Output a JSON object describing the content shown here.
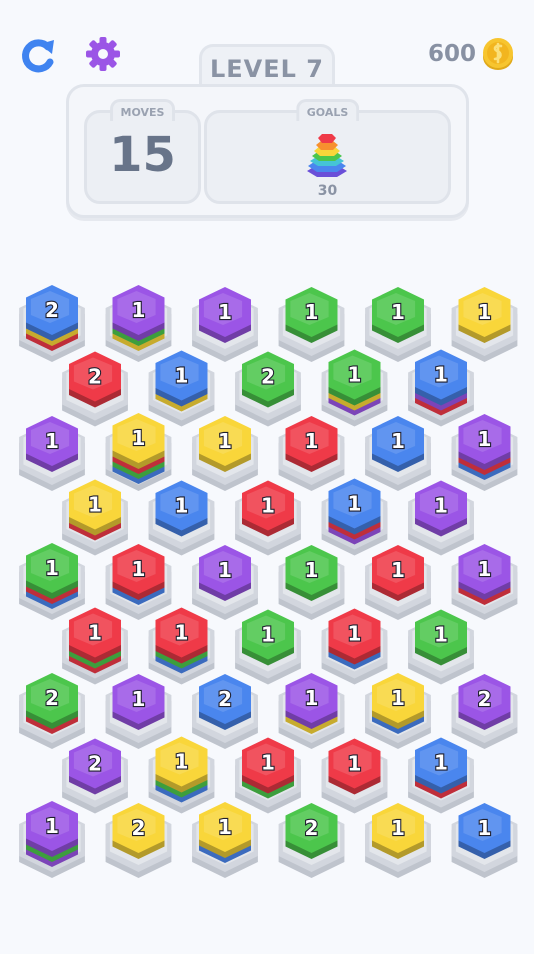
{
  "topbar": {
    "level_label": "LEVEL 7",
    "coins": "600",
    "restart_icon": "restart-icon",
    "settings_icon": "gear-icon"
  },
  "panel": {
    "moves_label": "MOVES",
    "moves_value": "15",
    "goals_label": "GOALS",
    "goal_count": "30",
    "goal_icon": "rainbow-hex-stack-icon"
  },
  "colors": {
    "red": "#ef3a48",
    "blue": "#4a86ee",
    "green": "#4cc64c",
    "purple": "#9b55e6",
    "yellow": "#f9d63a",
    "base": "#d2d6de",
    "page": "#f7f9fd"
  },
  "board": {
    "rows": [
      [
        {
          "color": "blue",
          "value": "2",
          "layers": [
            "yellow",
            "red"
          ]
        },
        {
          "color": "purple",
          "value": "1",
          "layers": [
            "green",
            "yellow"
          ]
        },
        {
          "color": "purple",
          "value": "1",
          "layers": []
        },
        {
          "color": "green",
          "value": "1",
          "layers": []
        },
        {
          "color": "green",
          "value": "1",
          "layers": []
        },
        {
          "color": "yellow",
          "value": "1",
          "layers": []
        }
      ],
      [
        {
          "color": "red",
          "value": "2",
          "layers": []
        },
        {
          "color": "blue",
          "value": "1",
          "layers": [
            "yellow"
          ]
        },
        {
          "color": "green",
          "value": "2",
          "layers": []
        },
        {
          "color": "green",
          "value": "1",
          "layers": [
            "yellow",
            "purple"
          ]
        },
        {
          "color": "blue",
          "value": "1",
          "layers": [
            "purple",
            "red"
          ]
        }
      ],
      [
        {
          "color": "purple",
          "value": "1",
          "layers": []
        },
        {
          "color": "yellow",
          "value": "1",
          "layers": [
            "red",
            "green",
            "blue"
          ]
        },
        {
          "color": "yellow",
          "value": "1",
          "layers": []
        },
        {
          "color": "red",
          "value": "1",
          "layers": []
        },
        {
          "color": "blue",
          "value": "1",
          "layers": []
        },
        {
          "color": "purple",
          "value": "1",
          "layers": [
            "red",
            "blue"
          ]
        }
      ],
      [
        {
          "color": "yellow",
          "value": "1",
          "layers": [
            "red"
          ]
        },
        {
          "color": "blue",
          "value": "1",
          "layers": []
        },
        {
          "color": "red",
          "value": "1",
          "layers": []
        },
        {
          "color": "blue",
          "value": "1",
          "layers": [
            "red",
            "purple"
          ]
        },
        {
          "color": "purple",
          "value": "1",
          "layers": []
        }
      ],
      [
        {
          "color": "green",
          "value": "1",
          "layers": [
            "red",
            "blue"
          ]
        },
        {
          "color": "red",
          "value": "1",
          "layers": [
            "blue"
          ]
        },
        {
          "color": "purple",
          "value": "1",
          "layers": []
        },
        {
          "color": "green",
          "value": "1",
          "layers": []
        },
        {
          "color": "red",
          "value": "1",
          "layers": []
        },
        {
          "color": "purple",
          "value": "1",
          "layers": [
            "red"
          ]
        }
      ],
      [
        {
          "color": "red",
          "value": "1",
          "layers": [
            "green",
            "red"
          ]
        },
        {
          "color": "red",
          "value": "1",
          "layers": [
            "green",
            "blue"
          ]
        },
        {
          "color": "green",
          "value": "1",
          "layers": []
        },
        {
          "color": "red",
          "value": "1",
          "layers": [
            "blue"
          ]
        },
        {
          "color": "green",
          "value": "1",
          "layers": []
        }
      ],
      [
        {
          "color": "green",
          "value": "2",
          "layers": [
            "red"
          ]
        },
        {
          "color": "purple",
          "value": "1",
          "layers": []
        },
        {
          "color": "blue",
          "value": "2",
          "layers": []
        },
        {
          "color": "purple",
          "value": "1",
          "layers": [
            "yellow"
          ]
        },
        {
          "color": "yellow",
          "value": "1",
          "layers": [
            "blue"
          ]
        },
        {
          "color": "purple",
          "value": "2",
          "layers": []
        }
      ],
      [
        {
          "color": "purple",
          "value": "2",
          "layers": []
        },
        {
          "color": "yellow",
          "value": "1",
          "layers": [
            "green",
            "blue"
          ]
        },
        {
          "color": "red",
          "value": "1",
          "layers": [
            "green"
          ]
        },
        {
          "color": "red",
          "value": "1",
          "layers": []
        },
        {
          "color": "blue",
          "value": "1",
          "layers": [
            "red"
          ]
        }
      ],
      [
        {
          "color": "purple",
          "value": "1",
          "layers": [
            "green",
            "purple"
          ]
        },
        {
          "color": "yellow",
          "value": "2",
          "layers": []
        },
        {
          "color": "yellow",
          "value": "1",
          "layers": [
            "blue"
          ]
        },
        {
          "color": "green",
          "value": "2",
          "layers": []
        },
        {
          "color": "yellow",
          "value": "1",
          "layers": []
        },
        {
          "color": "blue",
          "value": "1",
          "layers": []
        }
      ]
    ]
  }
}
